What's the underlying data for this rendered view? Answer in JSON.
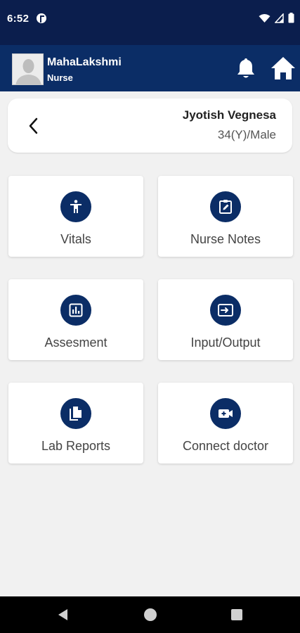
{
  "status_bar": {
    "time": "6:52"
  },
  "header": {
    "user_name": "MahaLakshmi",
    "user_role": "Nurse",
    "colors": {
      "background": "#0b2d66",
      "status_bar": "#0b1e4d"
    }
  },
  "patient": {
    "name": "Jyotish Vegnesa",
    "details": "34(Y)/Male"
  },
  "menu": {
    "tiles": [
      {
        "label": "Vitals",
        "icon": "accessibility-icon"
      },
      {
        "label": "Nurse Notes",
        "icon": "edit-note-icon"
      },
      {
        "label": "Assesment",
        "icon": "bar-chart-icon"
      },
      {
        "label": "Input/Output",
        "icon": "input-icon"
      },
      {
        "label": "Lab Reports",
        "icon": "documents-icon"
      },
      {
        "label": "Connect doctor",
        "icon": "video-call-icon"
      }
    ],
    "accent": "#0b2d66"
  }
}
